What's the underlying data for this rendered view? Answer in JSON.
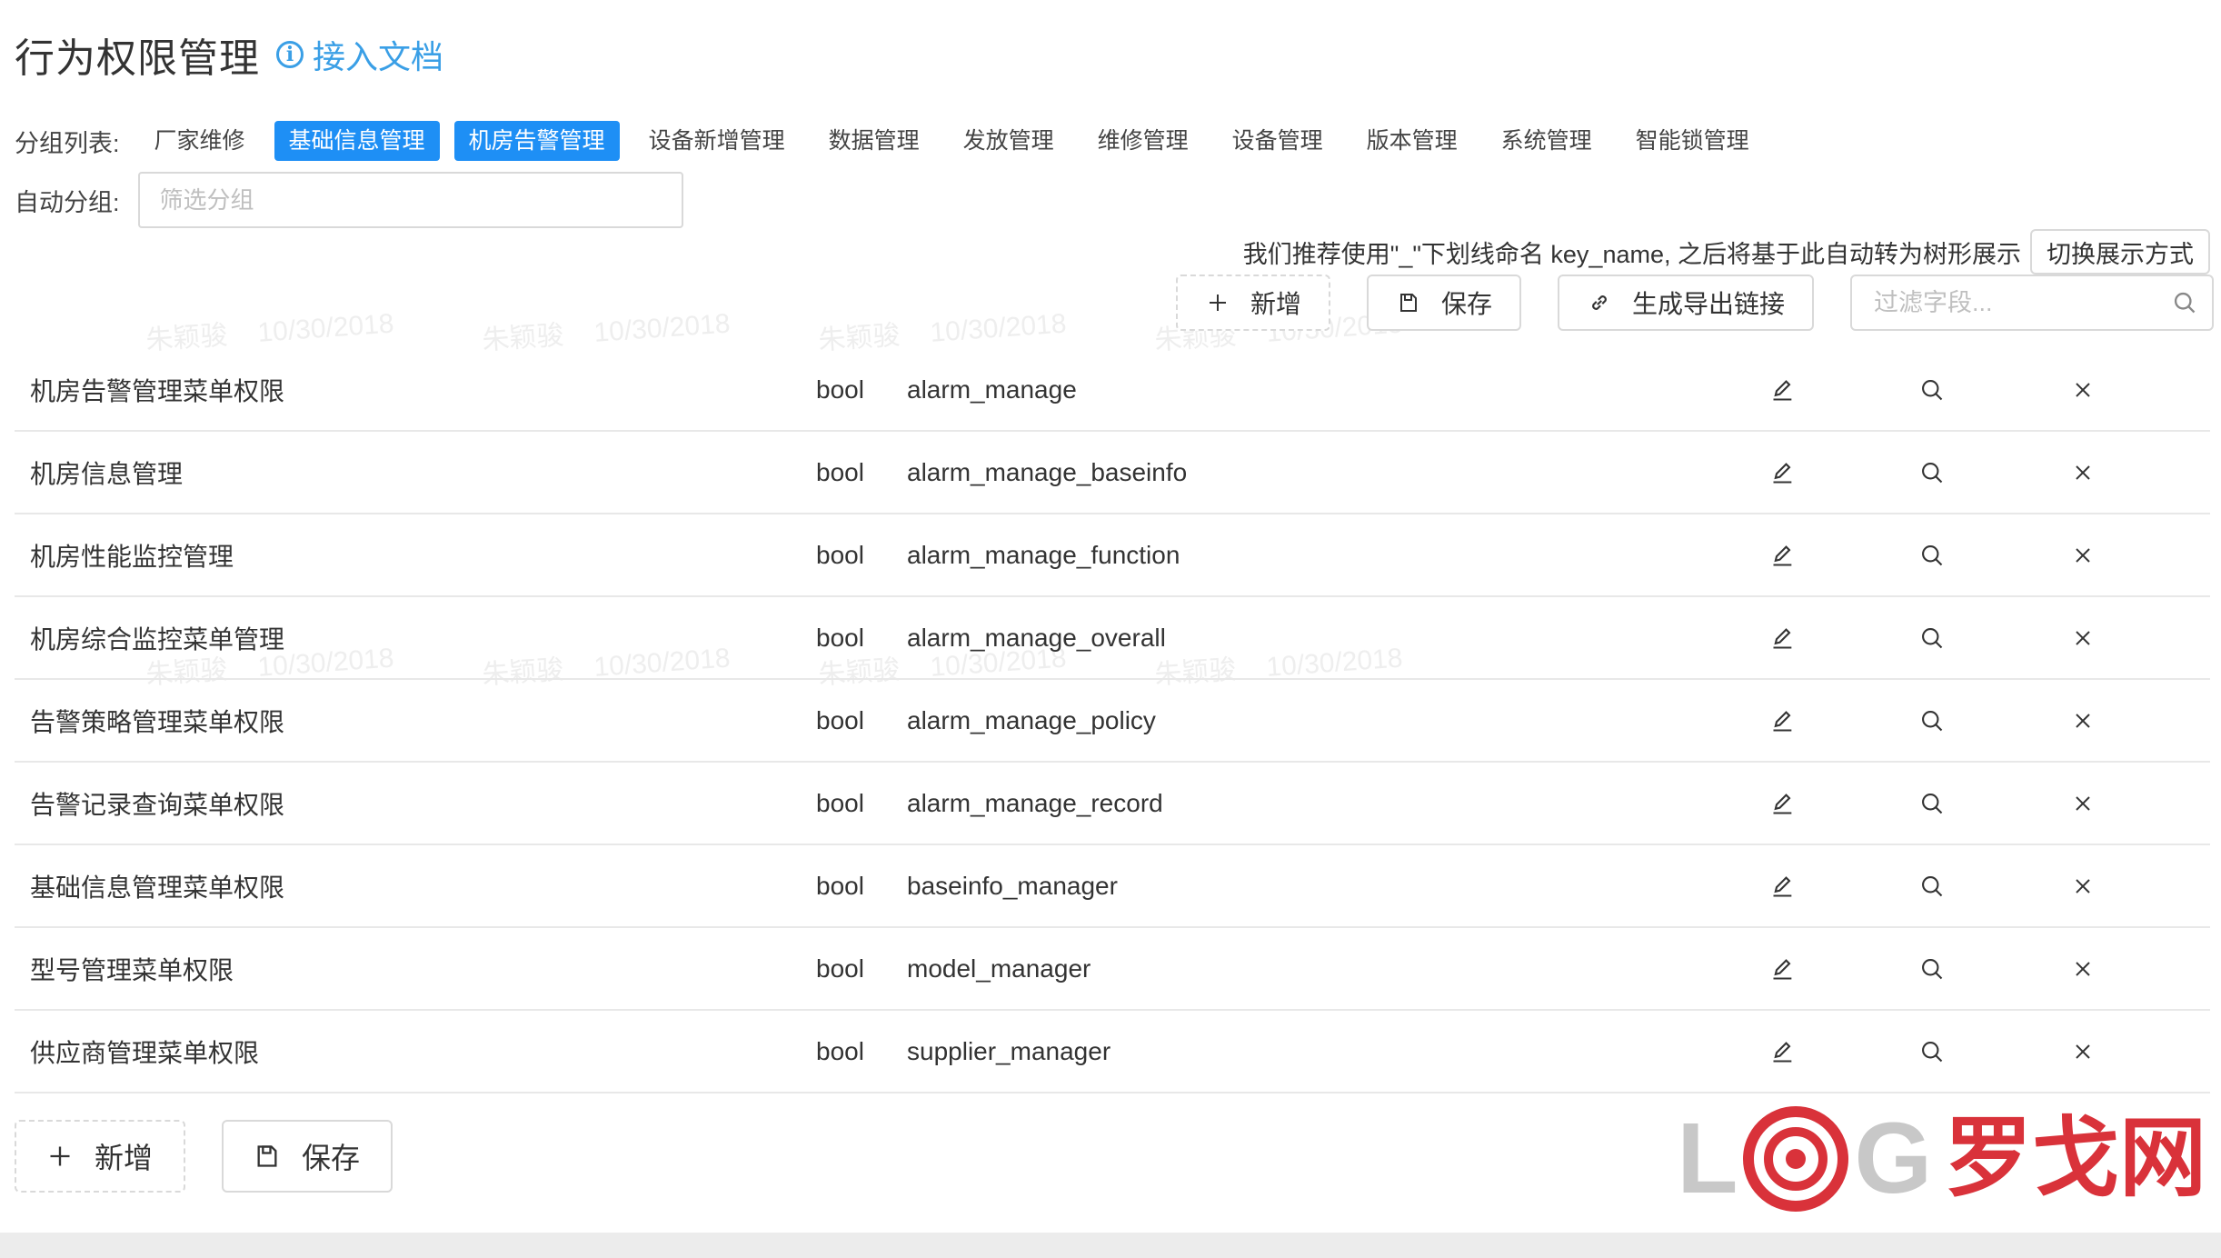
{
  "header": {
    "title": "行为权限管理",
    "doc_link": "接入文档"
  },
  "groups": {
    "label": "分组列表:",
    "items": [
      {
        "label": "厂家维修",
        "active": false
      },
      {
        "label": "基础信息管理",
        "active": true
      },
      {
        "label": "机房告警管理",
        "active": true
      },
      {
        "label": "设备新增管理",
        "active": false
      },
      {
        "label": "数据管理",
        "active": false
      },
      {
        "label": "发放管理",
        "active": false
      },
      {
        "label": "维修管理",
        "active": false
      },
      {
        "label": "设备管理",
        "active": false
      },
      {
        "label": "版本管理",
        "active": false
      },
      {
        "label": "系统管理",
        "active": false
      },
      {
        "label": "智能锁管理",
        "active": false
      }
    ]
  },
  "auto_group": {
    "label": "自动分组:",
    "placeholder": "筛选分组",
    "value": ""
  },
  "hint": {
    "text": "我们推荐使用\"_\"下划线命名 key_name, 之后将基于此自动转为树形展示",
    "switch_button": "切换展示方式"
  },
  "toolbar": {
    "add_label": "新增",
    "save_label": "保存",
    "export_label": "生成导出链接",
    "filter_placeholder": "过滤字段..."
  },
  "table": {
    "rows": [
      {
        "name": "机房告警管理菜单权限",
        "type": "bool",
        "key": "alarm_manage"
      },
      {
        "name": "机房信息管理",
        "type": "bool",
        "key": "alarm_manage_baseinfo"
      },
      {
        "name": "机房性能监控管理",
        "type": "bool",
        "key": "alarm_manage_function"
      },
      {
        "name": "机房综合监控菜单管理",
        "type": "bool",
        "key": "alarm_manage_overall"
      },
      {
        "name": "告警策略管理菜单权限",
        "type": "bool",
        "key": "alarm_manage_policy"
      },
      {
        "name": "告警记录查询菜单权限",
        "type": "bool",
        "key": "alarm_manage_record"
      },
      {
        "name": "基础信息管理菜单权限",
        "type": "bool",
        "key": "baseinfo_manager"
      },
      {
        "name": "型号管理菜单权限",
        "type": "bool",
        "key": "model_manager"
      },
      {
        "name": "供应商管理菜单权限",
        "type": "bool",
        "key": "supplier_manager"
      }
    ]
  },
  "bottom": {
    "add_label": "新增",
    "save_label": "保存"
  },
  "watermark": {
    "name": "朱颖骏",
    "date": "10/30/2018"
  },
  "logo": {
    "text_l": "L",
    "text_g": "G",
    "text_cn": "罗戈网"
  },
  "colors": {
    "accent": "#1e8ff5",
    "link": "#3a9fe6",
    "logo_red": "#d9323a"
  }
}
